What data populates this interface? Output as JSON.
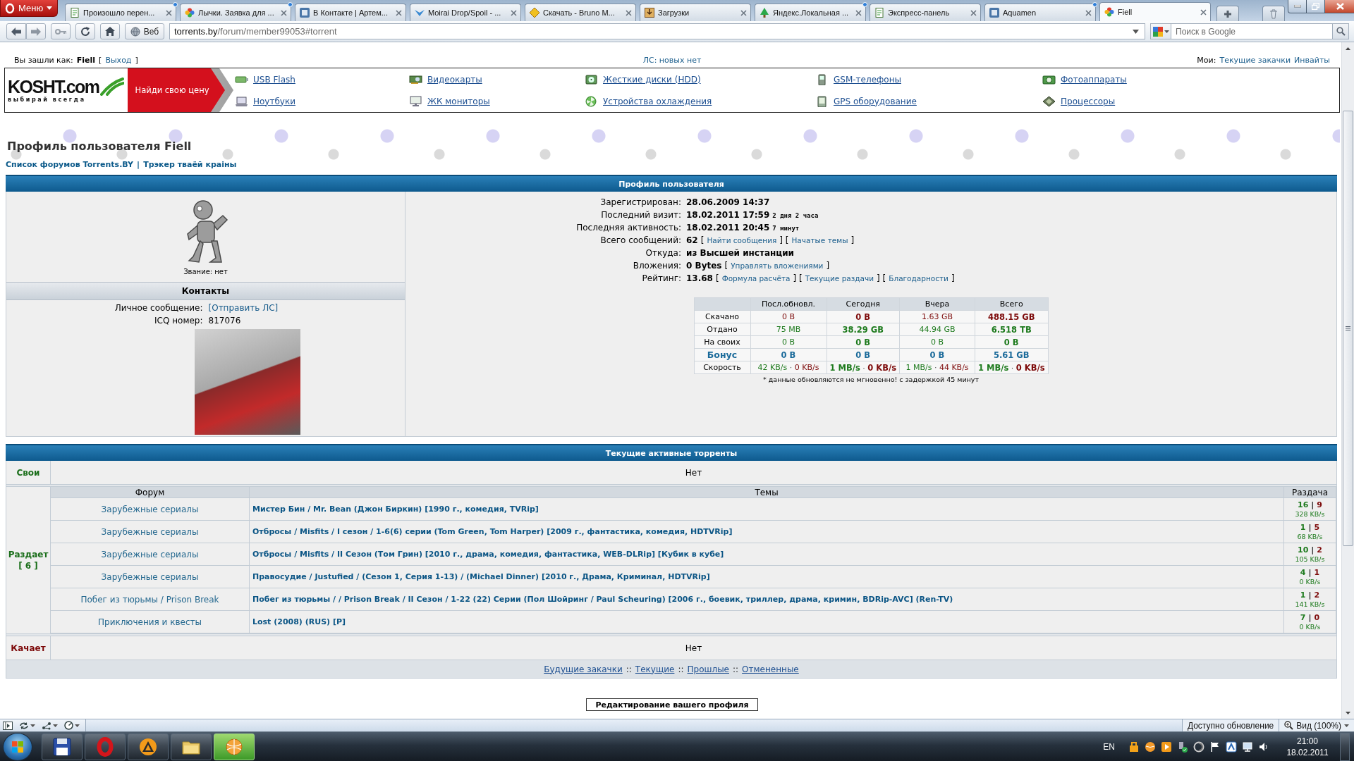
{
  "browser": {
    "menu_label": "Меню",
    "tabs": [
      {
        "title": "Произошло перен...",
        "kind": "page",
        "updated": true,
        "selected": false
      },
      {
        "title": "Лычки. Заявка для ...",
        "kind": "flower",
        "updated": true,
        "selected": false
      },
      {
        "title": "В Контакте | Артем...",
        "kind": "tile",
        "updated": false,
        "selected": false
      },
      {
        "title": "Moirai Drop/Spoil - ...",
        "kind": "bird",
        "updated": false,
        "selected": false
      },
      {
        "title": "Скачать - Bruno M...",
        "kind": "tag",
        "updated": false,
        "selected": false
      },
      {
        "title": "Загрузки",
        "kind": "download",
        "updated": false,
        "selected": false
      },
      {
        "title": "Яндекс.Локальная ...",
        "kind": "tree",
        "updated": true,
        "selected": false
      },
      {
        "title": "Экспресс-панель",
        "kind": "page",
        "updated": false,
        "selected": false
      },
      {
        "title": "Aquamen",
        "kind": "tile",
        "updated": true,
        "selected": false
      },
      {
        "title": "Fiell",
        "kind": "flower",
        "updated": false,
        "selected": true
      }
    ],
    "web_label": "Веб",
    "url_host": "torrents.by",
    "url_path": "/forum/member99053#torrent",
    "search_placeholder": "Поиск в Google"
  },
  "login_bar": {
    "prefix": "Вы зашли как:",
    "user": "Fiell",
    "open": "[",
    "logout": "Выход",
    "close": "]",
    "messages": "ЛС: новых нет",
    "my_label": "Мои:",
    "my_links": [
      "Текущие закачки",
      "Инвайты"
    ]
  },
  "ad_banner": {
    "logo": "KOSHT.com",
    "tagline": "выбирай всегда",
    "cta": "Найди свою цену",
    "columns": [
      [
        {
          "label": "USB Flash",
          "kind": "usb"
        },
        {
          "label": "Ноутбуки",
          "kind": "laptop"
        }
      ],
      [
        {
          "label": "Видеокарты",
          "kind": "gpu"
        },
        {
          "label": "ЖК мониторы",
          "kind": "monitor"
        }
      ],
      [
        {
          "label": "Жесткие диски (HDD)",
          "kind": "hdd"
        },
        {
          "label": "Устройства охлаждения",
          "kind": "fan"
        }
      ],
      [
        {
          "label": "GSM-телефоны",
          "kind": "phone"
        },
        {
          "label": "GPS оборудование",
          "kind": "gps"
        }
      ],
      [
        {
          "label": "Фотоаппараты",
          "kind": "camera"
        },
        {
          "label": "Процессоры",
          "kind": "chip"
        }
      ]
    ]
  },
  "profile": {
    "title": "Профиль пользователя Fiell",
    "breadcrumb": {
      "links": [
        "Список форумов Torrents.BY",
        "Трэкер тваёй краіны"
      ],
      "separator": "|"
    },
    "heading": "Профиль пользователя",
    "rank": "Звание: нет",
    "contacts_heading": "Контакты",
    "contacts": [
      {
        "label": "Личное сообщение:",
        "value": "[Отправить ЛС]",
        "kind": "link"
      },
      {
        "label": "ICQ номер:",
        "value": "817076",
        "kind": "text"
      }
    ],
    "info": [
      {
        "label": "Зарегистрирован:",
        "parts": [
          {
            "kind": "value",
            "text": "28.06.2009 14:37"
          }
        ]
      },
      {
        "label": "Последний визит:",
        "parts": [
          {
            "kind": "value",
            "text": "18.02.2011 17:59"
          },
          {
            "kind": "note",
            "text": "2 дня 2 часа"
          }
        ]
      },
      {
        "label": "Последняя активность:",
        "parts": [
          {
            "kind": "value",
            "text": "18.02.2011 20:45"
          },
          {
            "kind": "note",
            "text": "7 минут"
          }
        ]
      },
      {
        "label": "Всего сообщений:",
        "parts": [
          {
            "kind": "value",
            "text": "62"
          },
          {
            "kind": "text",
            "text": "["
          },
          {
            "kind": "link",
            "text": "Найти сообщения"
          },
          {
            "kind": "text",
            "text": "] ["
          },
          {
            "kind": "link",
            "text": "Начатые темы"
          },
          {
            "kind": "text",
            "text": "]"
          }
        ]
      },
      {
        "label": "Откуда:",
        "parts": [
          {
            "kind": "value",
            "text": "из Высшей инстанции"
          }
        ]
      },
      {
        "label": "Вложения:",
        "parts": [
          {
            "kind": "value",
            "text": "0 Bytes"
          },
          {
            "kind": "text",
            "text": "["
          },
          {
            "kind": "link",
            "text": "Управлять вложениями"
          },
          {
            "kind": "text",
            "text": "]"
          }
        ]
      },
      {
        "label": "Рейтинг:",
        "parts": [
          {
            "kind": "value",
            "text": "13.68"
          },
          {
            "kind": "text",
            "text": "["
          },
          {
            "kind": "link",
            "text": "Формула расчёта"
          },
          {
            "kind": "text",
            "text": "] ["
          },
          {
            "kind": "link",
            "text": "Текущие раздачи"
          },
          {
            "kind": "text",
            "text": "] ["
          },
          {
            "kind": "link",
            "text": "Благодарности"
          },
          {
            "kind": "text",
            "text": "]"
          }
        ]
      }
    ],
    "stats": {
      "columns": [
        {
          "label": "Посл.обновл.",
          "bold": false
        },
        {
          "label": "Сегодня",
          "bold": true
        },
        {
          "label": "Вчера",
          "bold": false
        },
        {
          "label": "Всего",
          "bold": true
        }
      ],
      "rows": [
        {
          "label": "Скачано",
          "kind": "down",
          "cells": [
            "0 B",
            "0 B",
            "1.63 GB",
            "488.15 GB"
          ]
        },
        {
          "label": "Отдано",
          "kind": "up",
          "cells": [
            "75 MB",
            "38.29 GB",
            "44.94 GB",
            "6.518 TB"
          ]
        },
        {
          "label": "На своих",
          "kind": "own",
          "cells": [
            "0 B",
            "0 B",
            "0 B",
            "0 B"
          ]
        },
        {
          "label": "Бонус",
          "kind": "bonus",
          "cells": [
            "0 B",
            "0 B",
            "0 B",
            "5.61 GB"
          ]
        }
      ],
      "speed": {
        "label": "Скорость",
        "separator": "·",
        "cells": [
          {
            "up": "42 KB/s",
            "down": "0 KB/s"
          },
          {
            "up": "1 MB/s",
            "down": "0 KB/s"
          },
          {
            "up": "1 MB/s",
            "down": "44 KB/s"
          },
          {
            "up": "1 MB/s",
            "down": "0 KB/s"
          }
        ]
      },
      "note": "* данные обновляются не мгновенно! с задержкой 45 минут"
    }
  },
  "torrents": {
    "heading": "Текущие активные торренты",
    "own": {
      "label": "Свои",
      "value": "Нет"
    },
    "seeding": {
      "label": "Раздает",
      "count": "[ 6 ]",
      "columns": [
        "Форум",
        "Темы",
        "Раздача"
      ],
      "separator": "|",
      "rows": [
        {
          "forum": "Зарубежные сериалы",
          "topic": "Мистер Бин / Mr. Bean (Джон Биркин) [1990 г., комедия, TVRip]",
          "seeders": "16",
          "leechers": "9",
          "speed": "328 KB/s"
        },
        {
          "forum": "Зарубежные сериалы",
          "topic": "Отбросы / Misfits / I сезон / 1-6(6) серии (Tom Green, Tom Harper) [2009 г., фантастика, комедия, HDTVRip]",
          "seeders": "1",
          "leechers": "5",
          "speed": "68 KB/s"
        },
        {
          "forum": "Зарубежные сериалы",
          "topic": "Отбросы / Misfits / II Сезон (Том Грин) [2010 г., драма, комедия, фантастика, WEB-DLRip] [Кубик в кубе]",
          "seeders": "10",
          "leechers": "2",
          "speed": "105 KB/s"
        },
        {
          "forum": "Зарубежные сериалы",
          "topic": "Правосудие / Justufied / (Сезон 1, Серия 1-13) / (Michael Dinner) [2010 г., Драма, Криминал, HDTVRip]",
          "seeders": "4",
          "leechers": "1",
          "speed": "0 KB/s"
        },
        {
          "forum": "Побег из тюрьмы / Prison Break",
          "topic": "Побег из тюрьмы / / Prison Break / II Сезон / 1-22 (22) Серии (Пол Шойринг / Paul Scheuring) [2006 г., боевик, триллер, драма, кримин, BDRip-AVC] (Ren-TV)",
          "seeders": "1",
          "leechers": "2",
          "speed": "141 KB/s"
        },
        {
          "forum": "Приключения и квесты",
          "topic": "Lost (2008) (RUS) [P]",
          "seeders": "7",
          "leechers": "0",
          "speed": "0 KB/s"
        }
      ]
    },
    "leeching": {
      "label": "Качает",
      "value": "Нет"
    },
    "links": [
      "Будущие закачки",
      "Текущие",
      "Прошлые",
      "Отмененные"
    ],
    "links_separator": "::"
  },
  "edit_button": "Редактирование вашего профиля",
  "status_bar": {
    "update": "Доступно обновление",
    "zoom": "Вид (100%)"
  },
  "taskbar": {
    "pinned": [
      {
        "kind": "floppy",
        "active": false
      },
      {
        "kind": "ring",
        "active": false
      },
      {
        "kind": "triangle",
        "active": false
      },
      {
        "kind": "folder",
        "active": false
      },
      {
        "kind": "ball",
        "active": true
      }
    ],
    "language": "EN",
    "time": "21:00",
    "date": "18.02.2011"
  }
}
